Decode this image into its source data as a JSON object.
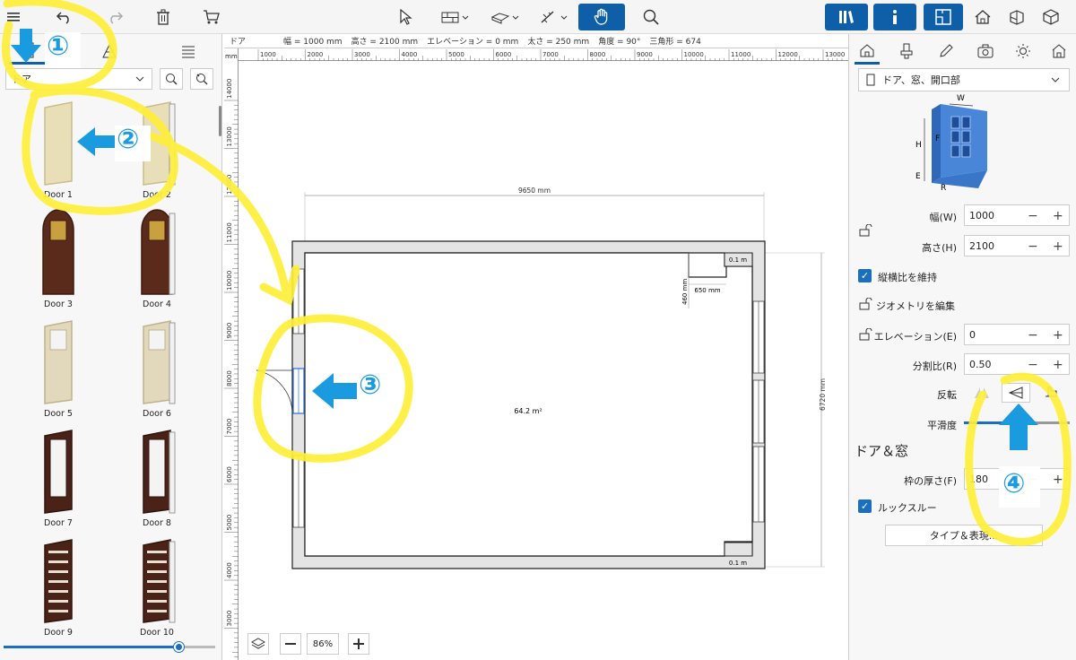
{
  "toolbar": {
    "left_icons": [
      "hamburger-icon",
      "undo-icon",
      "redo-icon",
      "trash-icon",
      "cart-icon"
    ],
    "center_icons": [
      "pointer-icon",
      "wall-tool-icon",
      "slab-tool-icon",
      "measure-tool-icon",
      "hand-pan-icon",
      "search-icon"
    ],
    "right_icons": [
      "library-icon",
      "info-icon",
      "floorplan-icon",
      "house-icon",
      "section-icon",
      "3d-cube-icon"
    ]
  },
  "left_panel": {
    "category": "ドア",
    "doors": [
      {
        "label": "Door 1",
        "style": "plain-beige"
      },
      {
        "label": "Door 2",
        "style": "beige-open"
      },
      {
        "label": "Door 3",
        "style": "arched-brown"
      },
      {
        "label": "Door 4",
        "style": "arched-brown-open"
      },
      {
        "label": "Door 5",
        "style": "beige-glass"
      },
      {
        "label": "Door 6",
        "style": "beige-glass-open"
      },
      {
        "label": "Door 7",
        "style": "brown-glass"
      },
      {
        "label": "Door 8",
        "style": "brown-glass-open"
      },
      {
        "label": "Door 9",
        "style": "brown-slats"
      },
      {
        "label": "Door 10",
        "style": "brown-slats-open"
      }
    ],
    "slider_value": 0.83
  },
  "infobar": {
    "type": "ドア",
    "width": "幅 = 1000 mm",
    "height": "高さ = 2100 mm",
    "elevation": "エレベーション = 0 mm",
    "thickness": "太さ = 250 mm",
    "angle": "角度 = 90°",
    "triangle": "三角形 = 674"
  },
  "rulers": {
    "unit": "mm",
    "top": [
      "1000",
      "2000",
      "3000",
      "4000",
      "5000",
      "6000",
      "7000",
      "8000",
      "9000",
      "10000",
      "11000",
      "12000",
      "13000"
    ],
    "left": [
      "14000",
      "13000",
      "12000",
      "11000",
      "10000",
      "9000",
      "8000",
      "7000",
      "6000",
      "5000",
      "4000",
      "3000"
    ]
  },
  "plan": {
    "width_dim": "9650 mm",
    "height_dim": "6720 mm",
    "niche_w": "650 mm",
    "niche_h": "460 mm",
    "area": "64.2 m²",
    "col_top": "0.1 m",
    "col_bot": "0.1 m"
  },
  "zoom": {
    "value": "86%"
  },
  "right_panel": {
    "category": "ドア、窓、開口部",
    "diagram_labels": {
      "w": "W",
      "h": "H",
      "f": "F",
      "e": "E",
      "r": "R"
    },
    "props": {
      "width_label": "幅(W)",
      "width_value": "1000",
      "height_label": "高さ(H)",
      "height_value": "2100",
      "keep_ratio": "縦横比を維持",
      "edit_geometry": "ジオメトリを編集",
      "elevation_label": "エレベーション(E)",
      "elevation_value": "0",
      "split_label": "分割比(R)",
      "split_value": "0.50",
      "flip_label": "反転",
      "smooth_label": "平滑度",
      "section_title": "ドア＆窓",
      "frame_label": "枠の厚さ(F)",
      "frame_value": "180",
      "lookthrough": "ルックスルー",
      "type_button": "タイプ＆表現..."
    }
  },
  "annotations": {
    "n1": "①",
    "n2": "②",
    "n3": "③",
    "n4": "④",
    "highlight_color": "#ffef3a",
    "arrow_color": "#1a9be0"
  }
}
